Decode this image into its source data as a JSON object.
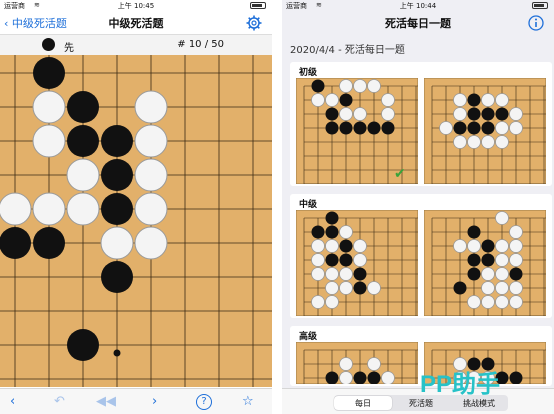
{
  "colors": {
    "accent": "#1e6fd9",
    "board_wood": "#e2b06a",
    "watermark": "#27c2c8",
    "check": "#3aa33a"
  },
  "left": {
    "status": {
      "carrier": "运营商",
      "time": "上午 10:45"
    },
    "nav": {
      "back_label": "中级死活题",
      "title": "中级死活题",
      "settings_icon": "gear-icon"
    },
    "info": {
      "to_move": "先",
      "progress": "# 10 / 50"
    },
    "board": {
      "cols": 11,
      "rows": 11,
      "black": [
        [
          1,
          0
        ],
        [
          2,
          1
        ],
        [
          3,
          2
        ],
        [
          2,
          2
        ],
        [
          3,
          3
        ],
        [
          3,
          4
        ],
        [
          0,
          5
        ],
        [
          1,
          5
        ],
        [
          3,
          6
        ],
        [
          2,
          8
        ]
      ],
      "white": [
        [
          1,
          1
        ],
        [
          4,
          1
        ],
        [
          1,
          2
        ],
        [
          4,
          2
        ],
        [
          2,
          3
        ],
        [
          4,
          3
        ],
        [
          0,
          4
        ],
        [
          1,
          4
        ],
        [
          2,
          4
        ],
        [
          4,
          4
        ],
        [
          3,
          5
        ],
        [
          4,
          5
        ]
      ],
      "marker": [
        3,
        10
      ]
    },
    "toolbar": [
      {
        "name": "prev-icon",
        "glyph": "‹"
      },
      {
        "name": "undo-icon",
        "glyph": "↶"
      },
      {
        "name": "rewind-icon",
        "glyph": "◀◀"
      },
      {
        "name": "next-icon",
        "glyph": "›"
      },
      {
        "name": "help-icon",
        "glyph": "?"
      },
      {
        "name": "star-icon",
        "glyph": "☆"
      }
    ]
  },
  "right": {
    "status": {
      "carrier": "运营商",
      "time": "上午 10:44"
    },
    "nav": {
      "title": "死活每日一题",
      "info_icon": "info-icon"
    },
    "date": "2020/4/4 - 死活每日一题",
    "levels": [
      {
        "label": "初级",
        "solved": true,
        "boards": [
          {
            "black": [
              [
                1,
                0
              ],
              [
                3,
                1
              ],
              [
                2,
                2
              ],
              [
                2,
                3
              ],
              [
                3,
                3
              ],
              [
                4,
                3
              ],
              [
                5,
                3
              ],
              [
                6,
                3
              ]
            ],
            "white": [
              [
                3,
                0
              ],
              [
                4,
                0
              ],
              [
                5,
                0
              ],
              [
                6,
                1
              ],
              [
                1,
                1
              ],
              [
                2,
                1
              ],
              [
                3,
                2
              ],
              [
                4,
                2
              ],
              [
                6,
                2
              ]
            ]
          },
          {
            "black": [
              [
                3,
                1
              ],
              [
                3,
                2
              ],
              [
                4,
                2
              ],
              [
                2,
                3
              ],
              [
                5,
                2
              ],
              [
                3,
                3
              ],
              [
                4,
                3
              ]
            ],
            "white": [
              [
                2,
                1
              ],
              [
                4,
                1
              ],
              [
                5,
                1
              ],
              [
                2,
                2
              ],
              [
                6,
                2
              ],
              [
                1,
                3
              ],
              [
                5,
                3
              ],
              [
                6,
                3
              ],
              [
                2,
                4
              ],
              [
                3,
                4
              ],
              [
                4,
                4
              ],
              [
                5,
                4
              ]
            ]
          }
        ]
      },
      {
        "label": "中级",
        "solved": false,
        "boards": [
          {
            "black": [
              [
                2,
                0
              ],
              [
                1,
                1
              ],
              [
                2,
                1
              ],
              [
                3,
                2
              ],
              [
                2,
                3
              ],
              [
                3,
                3
              ],
              [
                4,
                4
              ],
              [
                4,
                5
              ]
            ],
            "white": [
              [
                3,
                1
              ],
              [
                1,
                2
              ],
              [
                2,
                2
              ],
              [
                4,
                2
              ],
              [
                1,
                3
              ],
              [
                4,
                3
              ],
              [
                1,
                4
              ],
              [
                2,
                4
              ],
              [
                3,
                4
              ],
              [
                2,
                5
              ],
              [
                3,
                5
              ],
              [
                5,
                5
              ],
              [
                1,
                6
              ],
              [
                2,
                6
              ]
            ]
          },
          {
            "black": [
              [
                3,
                1
              ],
              [
                4,
                2
              ],
              [
                3,
                3
              ],
              [
                4,
                3
              ],
              [
                3,
                4
              ],
              [
                2,
                5
              ],
              [
                6,
                4
              ]
            ],
            "white": [
              [
                5,
                0
              ],
              [
                6,
                1
              ],
              [
                2,
                2
              ],
              [
                3,
                2
              ],
              [
                5,
                2
              ],
              [
                6,
                2
              ],
              [
                5,
                3
              ],
              [
                6,
                3
              ],
              [
                4,
                4
              ],
              [
                5,
                4
              ],
              [
                4,
                5
              ],
              [
                5,
                5
              ],
              [
                6,
                5
              ],
              [
                3,
                6
              ],
              [
                4,
                6
              ],
              [
                5,
                6
              ],
              [
                6,
                6
              ]
            ]
          }
        ]
      },
      {
        "label": "高级",
        "solved": false,
        "boards": [
          {
            "black": [
              [
                2,
                2
              ],
              [
                4,
                2
              ],
              [
                5,
                2
              ]
            ],
            "white": [
              [
                3,
                1
              ],
              [
                5,
                1
              ],
              [
                3,
                2
              ],
              [
                6,
                2
              ]
            ]
          },
          {
            "black": [
              [
                3,
                1
              ],
              [
                4,
                1
              ],
              [
                5,
                2
              ],
              [
                6,
                2
              ]
            ],
            "white": [
              [
                2,
                1
              ],
              [
                2,
                2
              ],
              [
                3,
                2
              ],
              [
                4,
                2
              ]
            ]
          }
        ]
      }
    ],
    "tabs": [
      {
        "label": "每日",
        "active": true
      },
      {
        "label": "死活题",
        "active": false
      },
      {
        "label": "挑战模式",
        "active": false
      }
    ]
  },
  "watermark": "PP助手"
}
